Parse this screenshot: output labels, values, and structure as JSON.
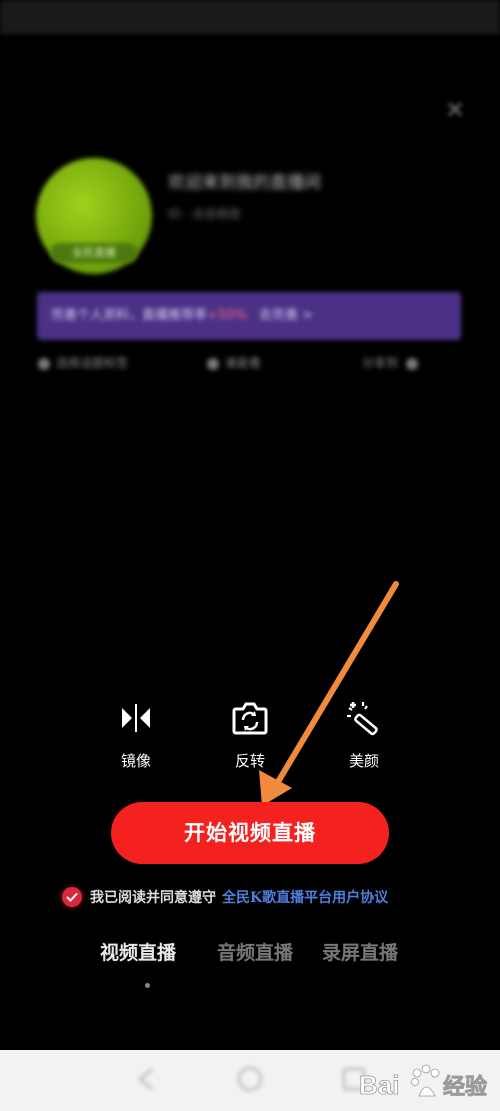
{
  "close_label": "✕",
  "profile": {
    "avatar_tag": "全民直播",
    "room_title": "欢迎来到我的直播间",
    "room_subtitle": "ID · 点击修改"
  },
  "banner": {
    "text_before": "完善个人资料，直播推荐率",
    "highlight": "+50%",
    "text_after": "去完善 >"
  },
  "options": [
    {
      "label": "选择话题标签"
    },
    {
      "label": "谁能看"
    },
    {
      "label": "分享到"
    }
  ],
  "tools": [
    {
      "label": "镜像",
      "icon": "mirror-icon"
    },
    {
      "label": "反转",
      "icon": "camera-flip-icon"
    },
    {
      "label": "美颜",
      "icon": "beauty-wand-icon"
    }
  ],
  "start_button": "开始视频直播",
  "agreement": {
    "text": "我已阅读并同意遵守",
    "link": "全民K歌直播平台用户协议"
  },
  "mode_tabs": [
    {
      "label": "视频直播",
      "active": true
    },
    {
      "label": "音频直播",
      "active": false
    },
    {
      "label": "录屏直播",
      "active": false
    }
  ],
  "watermark": "Bai经验",
  "colors": {
    "accent": "#f5211f",
    "link": "#4f7fdc",
    "banner": "#4a3185",
    "annotation_arrow": "#f08a3c"
  }
}
